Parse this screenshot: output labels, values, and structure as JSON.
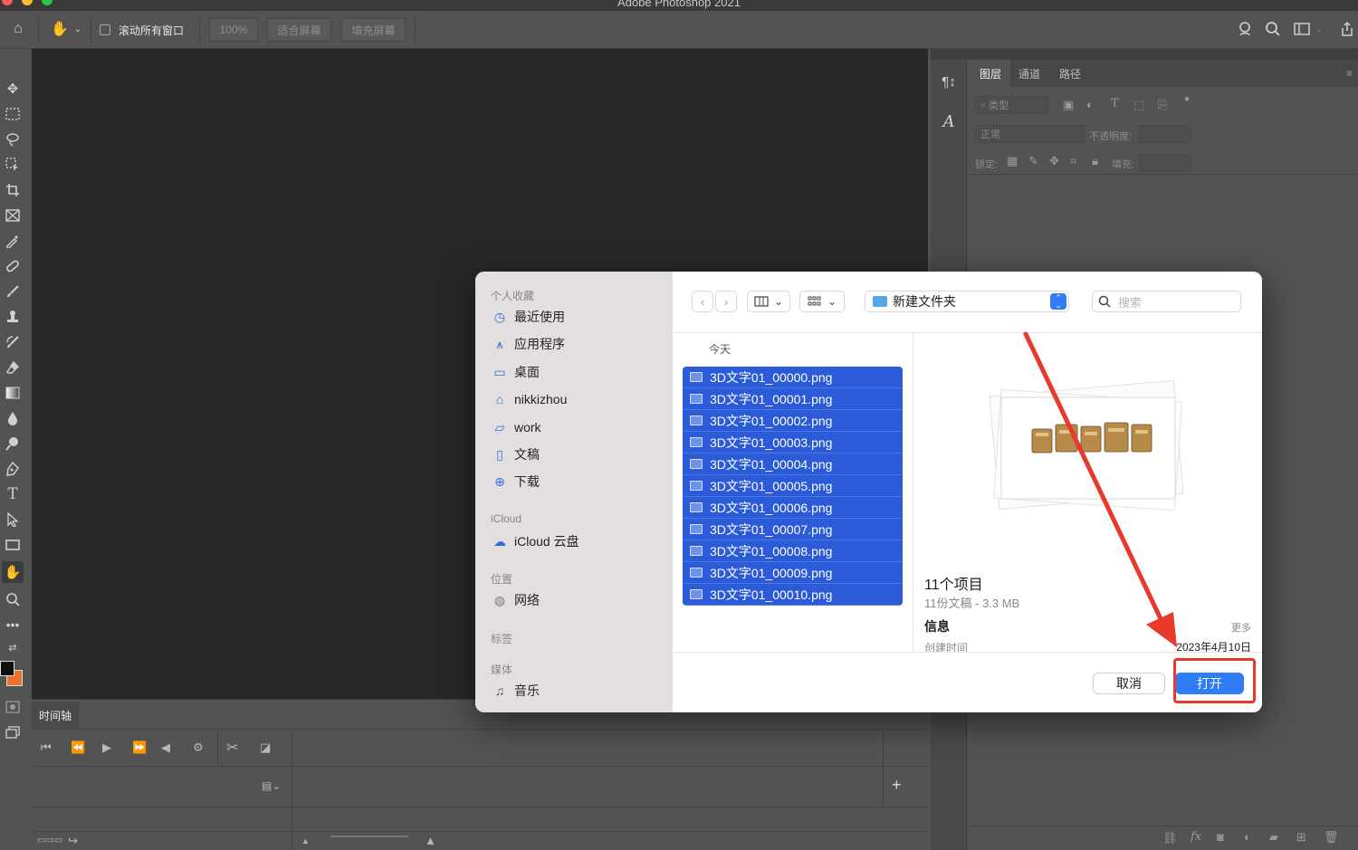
{
  "app": {
    "title": "Adobe Photoshop 2021"
  },
  "options_bar": {
    "scroll_all_label": "滚动所有窗口",
    "zoom_label": "100%",
    "fit_screen_label": "适合屏幕",
    "fill_screen_label": "填充屏幕"
  },
  "timeline": {
    "tab_label": "时间轴"
  },
  "layers_panel": {
    "tabs": [
      "图层",
      "通道",
      "路径"
    ],
    "filter_placeholder": "类型",
    "blend_mode": "正常",
    "opacity_label": "不透明度:",
    "lock_label": "锁定:",
    "fill_label": "填充:"
  },
  "dialog": {
    "sidebar": {
      "favorites_header": "个人收藏",
      "favorites": [
        {
          "label": "最近使用",
          "icon": "clock-icon"
        },
        {
          "label": "应用程序",
          "icon": "applications-icon"
        },
        {
          "label": "桌面",
          "icon": "desktop-icon"
        },
        {
          "label": "nikkizhou",
          "icon": "home-icon"
        },
        {
          "label": "work",
          "icon": "folder-icon"
        },
        {
          "label": "文稿",
          "icon": "document-icon"
        },
        {
          "label": "下载",
          "icon": "download-icon"
        }
      ],
      "icloud_header": "iCloud",
      "icloud_items": [
        {
          "label": "iCloud 云盘",
          "icon": "cloud-icon"
        }
      ],
      "locations_header": "位置",
      "locations": [
        {
          "label": "网络",
          "icon": "globe-icon"
        }
      ],
      "tags_header": "标签",
      "media_header": "媒体",
      "media": [
        {
          "label": "音乐",
          "icon": "music-icon"
        }
      ]
    },
    "toolbar": {
      "current_folder": "新建文件夹",
      "search_placeholder": "搜索"
    },
    "file_column": {
      "section_header": "今天",
      "files": [
        "3D文字01_00000.png",
        "3D文字01_00001.png",
        "3D文字01_00002.png",
        "3D文字01_00003.png",
        "3D文字01_00004.png",
        "3D文字01_00005.png",
        "3D文字01_00006.png",
        "3D文字01_00007.png",
        "3D文字01_00008.png",
        "3D文字01_00009.png",
        "3D文字01_00010.png"
      ]
    },
    "preview": {
      "title": "11个项目",
      "subtitle": "11份文稿 - 3.3 MB",
      "info_label": "信息",
      "more_label": "更多",
      "created_label": "创建时间",
      "created_value": "2023年4月10日"
    },
    "buttons": {
      "cancel": "取消",
      "open": "打开"
    }
  },
  "colors": {
    "accent": "#2f7cf6",
    "selection": "#2b5bd8",
    "annotation": "#e8392b",
    "canvas": "#282828",
    "panel": "#535353"
  }
}
